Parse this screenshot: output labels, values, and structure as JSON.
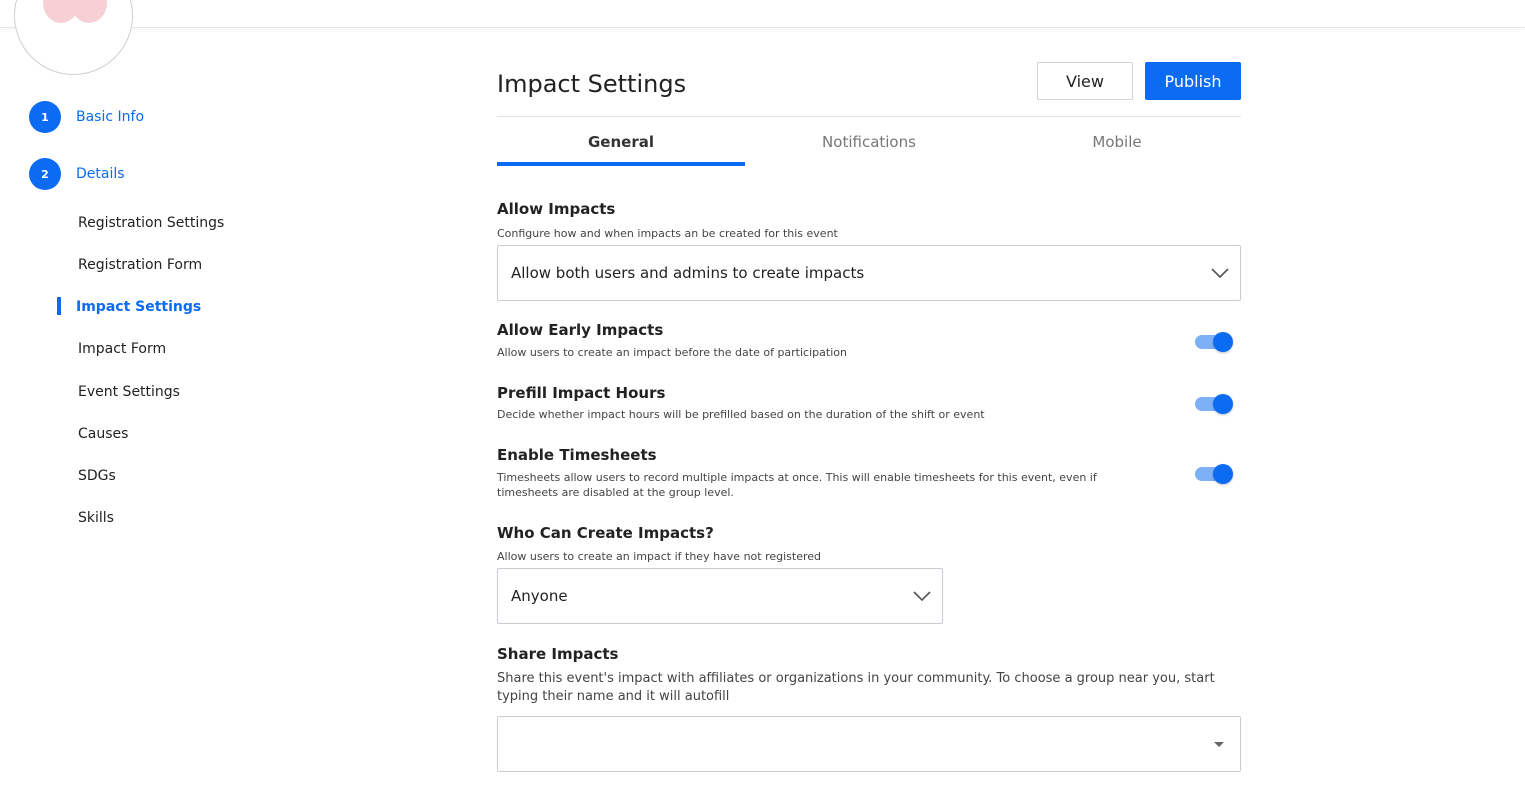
{
  "sidebar": {
    "steps": [
      {
        "number": "1",
        "label": "Basic Info"
      },
      {
        "number": "2",
        "label": "Details"
      }
    ],
    "items": [
      {
        "label": "Registration Settings"
      },
      {
        "label": "Registration Form"
      },
      {
        "label": "Impact Settings",
        "active": true
      },
      {
        "label": "Impact Form"
      },
      {
        "label": "Event Settings"
      },
      {
        "label": "Causes"
      },
      {
        "label": "SDGs"
      },
      {
        "label": "Skills"
      }
    ]
  },
  "header": {
    "title": "Impact Settings",
    "view_label": "View",
    "publish_label": "Publish"
  },
  "tabs": [
    {
      "label": "General",
      "active": true
    },
    {
      "label": "Notifications"
    },
    {
      "label": "Mobile"
    }
  ],
  "sections": {
    "allow_impacts": {
      "title": "Allow Impacts",
      "description": "Configure how and when impacts an be created for this event",
      "value": "Allow both users and admins to create impacts"
    },
    "early_impacts": {
      "title": "Allow Early Impacts",
      "description": "Allow users to create an impact before the date of participation",
      "enabled": true
    },
    "prefill_hours": {
      "title": "Prefill Impact Hours",
      "description": "Decide whether impact hours will be prefilled based on the duration of the shift or event",
      "enabled": true
    },
    "timesheets": {
      "title": "Enable Timesheets",
      "description_line1": "Timesheets allow users to record multiple impacts at once. This will enable timesheets for this event, even if",
      "description_line2": "timesheets are disabled at the group level.",
      "enabled": true
    },
    "who_can_create": {
      "title": "Who Can Create Impacts?",
      "description": "Allow users to create an impact if they have not registered",
      "value": "Anyone"
    },
    "share_impacts": {
      "title": "Share Impacts",
      "description_line1": "Share this event's impact with affiliates or organizations in your community. To choose a group near you, start",
      "description_line2": "typing their name and it will autofill",
      "value": ""
    }
  },
  "colors": {
    "accent": "#0b6bf2",
    "toggle_track": "#7eb0f6"
  },
  "icons": {
    "avatar": "cherry-blossom-icon",
    "dropdown": "chevron-down-icon",
    "caret": "caret-down-icon"
  }
}
